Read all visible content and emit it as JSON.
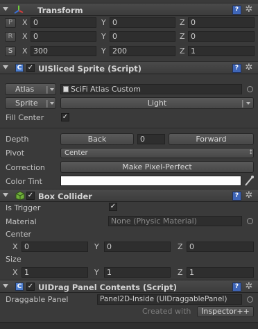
{
  "transform": {
    "title": "Transform",
    "rows": [
      {
        "btn": "P",
        "x_label": "X",
        "x": "0",
        "y_label": "Y",
        "y": "0",
        "z_label": "Z",
        "z": "0"
      },
      {
        "btn": "R",
        "x_label": "X",
        "x": "0",
        "y_label": "Y",
        "y": "0",
        "z_label": "Z",
        "z": "0"
      },
      {
        "btn": "S",
        "x_label": "X",
        "x": "300",
        "y_label": "Y",
        "y": "200",
        "z_label": "Z",
        "z": "1"
      }
    ]
  },
  "sliced_sprite": {
    "title": "UISliced Sprite (Script)",
    "atlas_label": "Atlas",
    "atlas_value": "SciFi Atlas Custom",
    "sprite_label": "Sprite",
    "sprite_value": "Light",
    "fill_center_label": "Fill Center",
    "depth_label": "Depth",
    "back_label": "Back",
    "depth_value": "0",
    "forward_label": "Forward",
    "pivot_label": "Pivot",
    "pivot_value": "Center",
    "correction_label": "Correction",
    "make_pixel_perfect_label": "Make Pixel-Perfect",
    "color_tint_label": "Color Tint",
    "color_tint_value": "#ffffff"
  },
  "box_collider": {
    "title": "Box Collider",
    "is_trigger_label": "Is Trigger",
    "material_label": "Material",
    "material_value": "None (Physic Material)",
    "center_label": "Center",
    "center": {
      "x_label": "X",
      "x": "0",
      "y_label": "Y",
      "y": "0",
      "z_label": "Z",
      "z": "0"
    },
    "size_label": "Size",
    "size": {
      "x_label": "X",
      "x": "1",
      "y_label": "Y",
      "y": "1",
      "z_label": "Z",
      "z": "1"
    }
  },
  "drag_panel": {
    "title": "UIDrag Panel Contents (Script)",
    "draggable_panel_label": "Draggable Panel",
    "draggable_panel_value": "Panel2D-Inside (UIDraggablePanel)",
    "created_with_label": "Created with",
    "inspector_label": "Inspector++"
  },
  "icons": {
    "help": "?",
    "gear": "✲",
    "check": "✓",
    "transform_color": "#e2c23a",
    "sprite_color": "#4f7fcf",
    "collider_color": "#6fae3a"
  }
}
